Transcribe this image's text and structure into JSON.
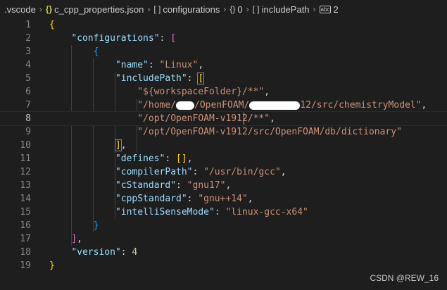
{
  "breadcrumb": {
    "items": [
      {
        "label": ".vscode",
        "icon": ""
      },
      {
        "label": "c_cpp_properties.json",
        "icon": "json-braces-icon"
      },
      {
        "label": "configurations",
        "icon": "array-icon"
      },
      {
        "label": "0",
        "icon": "object-icon"
      },
      {
        "label": "includePath",
        "icon": "array-icon"
      },
      {
        "label": "2",
        "icon": "number-icon"
      }
    ]
  },
  "editor": {
    "current_line": 8,
    "line_numbers": [
      "1",
      "2",
      "3",
      "4",
      "5",
      "6",
      "7",
      "8",
      "9",
      "10",
      "11",
      "12",
      "13",
      "14",
      "15",
      "16",
      "17",
      "18",
      "19"
    ],
    "json": {
      "key_configurations": "\"configurations\"",
      "key_name": "\"name\"",
      "val_name": "\"Linux\"",
      "key_includePath": "\"includePath\"",
      "inc_1": "\"${workspaceFolder}/**\"",
      "inc_2a": "\"/home/",
      "inc_2b": "/OpenFOAM/",
      "inc_2c": "12/src/chemistryModel\"",
      "inc_3a": "\"/opt/OpenFOAM-v1912",
      "inc_3b": "/**\"",
      "inc_4": "\"/opt/OpenFOAM-v1912/src/OpenFOAM/db/dictionary\"",
      "key_defines": "\"defines\"",
      "key_compilerPath": "\"compilerPath\"",
      "val_compilerPath": "\"/usr/bin/gcc\"",
      "key_cStandard": "\"cStandard\"",
      "val_cStandard": "\"gnu17\"",
      "key_cppStandard": "\"cppStandard\"",
      "val_cppStandard": "\"gnu++14\"",
      "key_intelliSenseMode": "\"intelliSenseMode\"",
      "val_intelliSenseMode": "\"linux-gcc-x64\"",
      "key_version": "\"version\"",
      "val_version": "4"
    }
  },
  "watermark": "CSDN @REW_16",
  "colors": {
    "background": "#1e1e1e",
    "key": "#9cdcfe",
    "string": "#ce9178",
    "number": "#b5cea8",
    "bracket_level1": "#ffd700",
    "bracket_level2": "#da70d6",
    "bracket_level3": "#179fff"
  }
}
